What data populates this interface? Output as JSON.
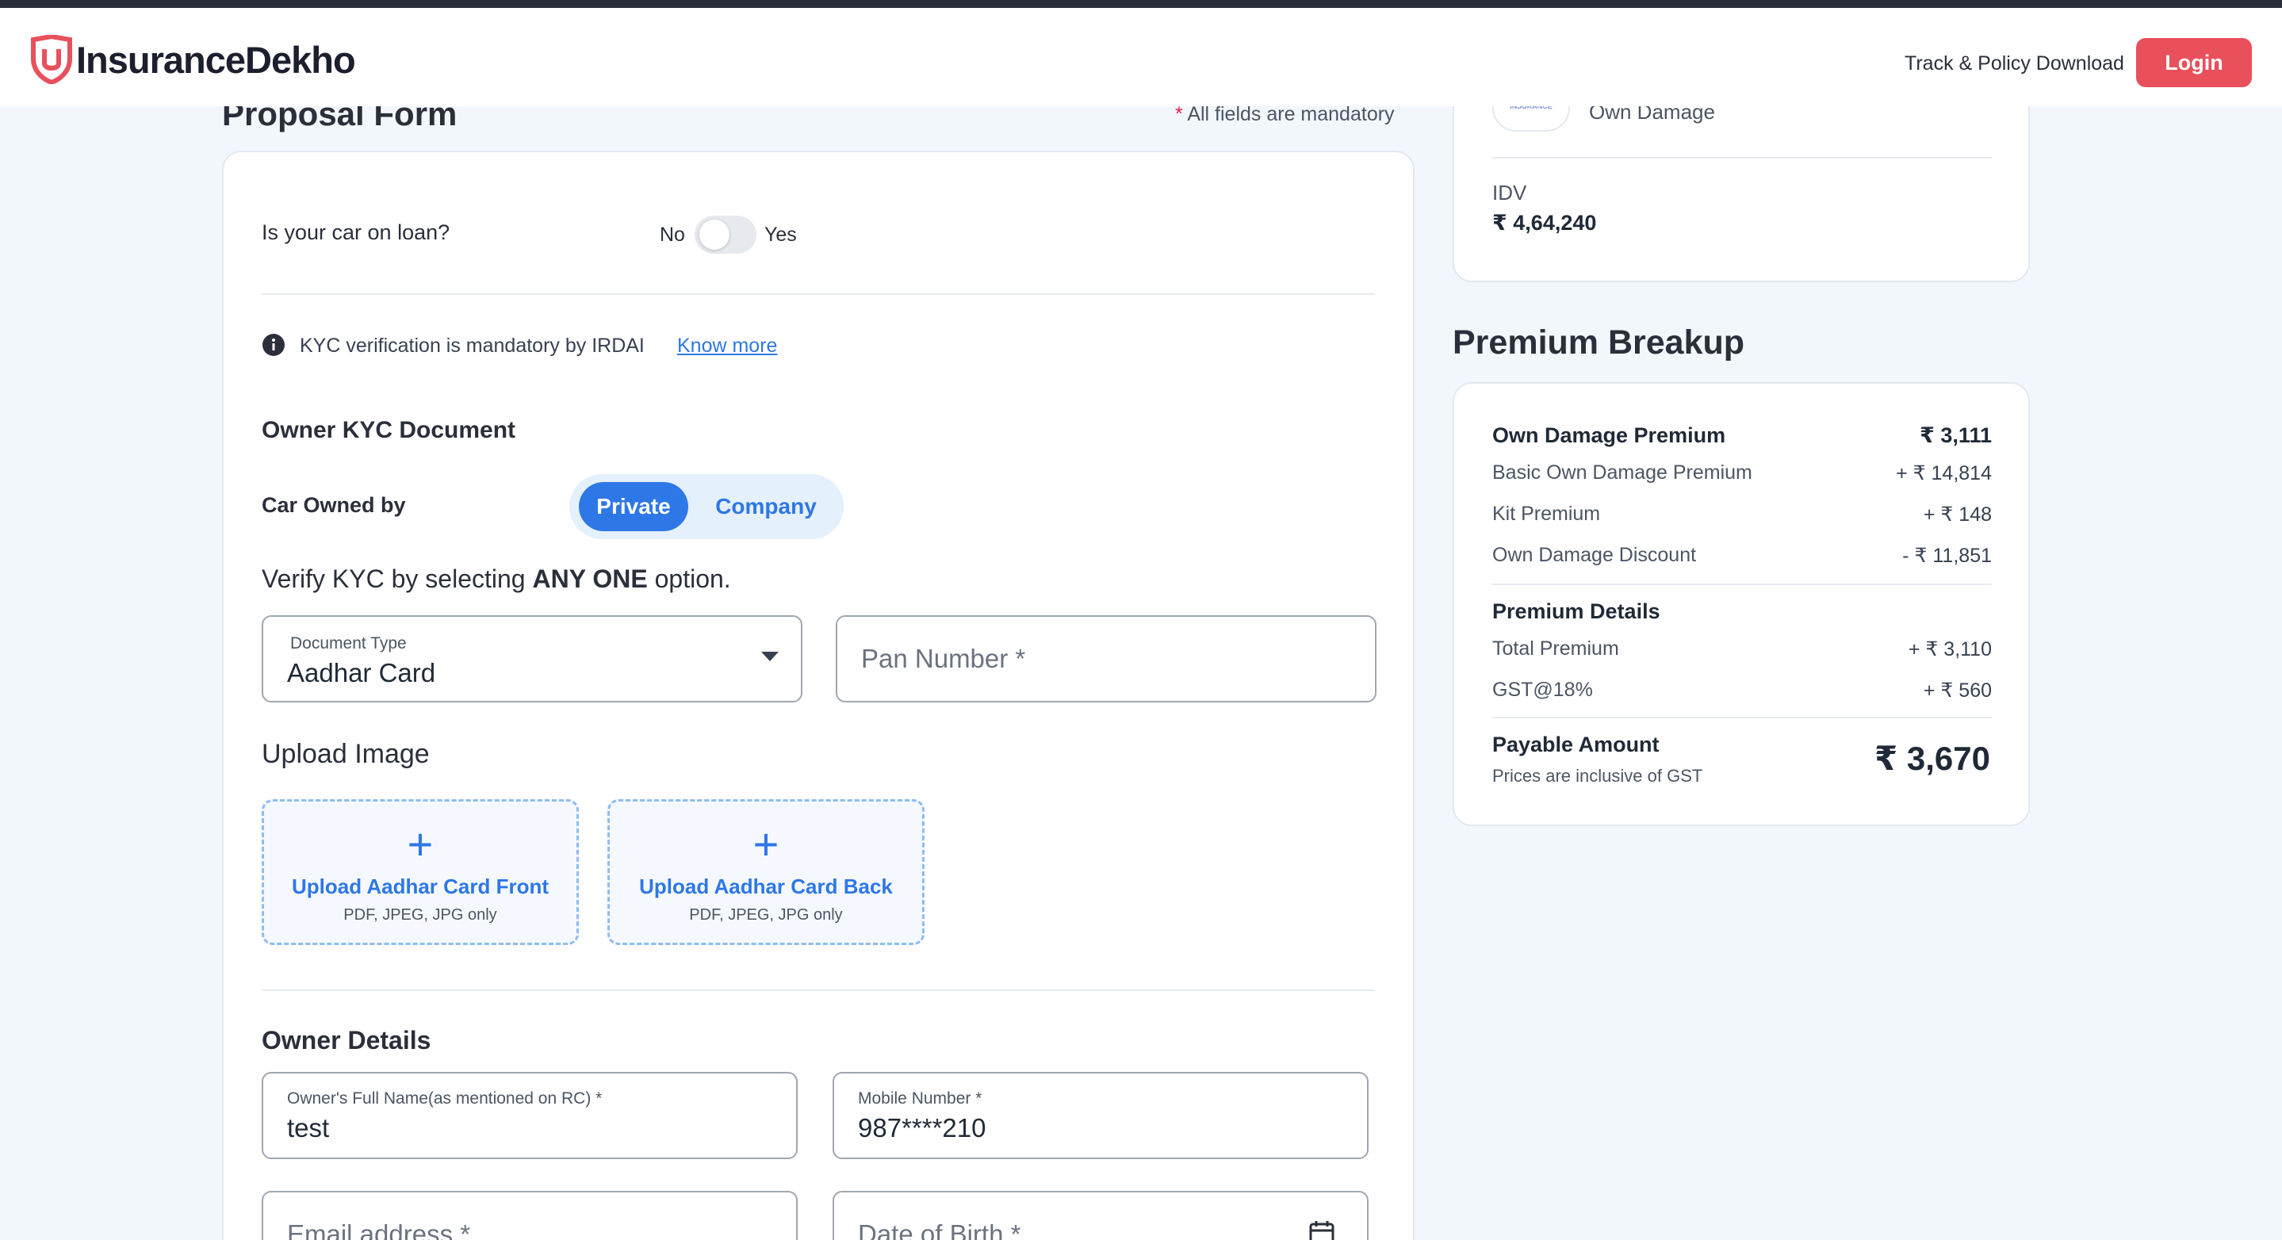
{
  "header": {
    "logo_text": "InsuranceDekho",
    "track_link": "Track & Policy Download",
    "login_label": "Login",
    "brand_color": "#e8505b"
  },
  "form": {
    "title": "Proposal Form",
    "mandatory_star": "*",
    "mandatory_note": "All fields are mandatory",
    "loan_question": "Is your car on loan?",
    "loan_no": "No",
    "loan_yes": "Yes",
    "loan_toggle_on": false,
    "kyc_note": "KYC verification is mandatory by IRDAI",
    "know_more": "Know more",
    "kyc_heading": "Owner KYC Document",
    "owned_by_label": "Car Owned by",
    "owned_by_private": "Private",
    "owned_by_company": "Company",
    "owned_by_selected": "Private",
    "verify_prefix": "Verify KYC by selecting ",
    "verify_bold": "ANY ONE",
    "verify_suffix": " option.",
    "document_type_label": "Document Type",
    "document_type_value": "Aadhar Card",
    "pan_placeholder": "Pan Number *",
    "upload_heading": "Upload Image",
    "upload_front_title": "Upload Aadhar Card Front",
    "upload_back_title": "Upload Aadhar Card Back",
    "upload_hint": "PDF, JPEG, JPG only",
    "owner_heading": "Owner Details",
    "full_name_label": "Owner's Full Name(as mentioned on RC) *",
    "full_name_value": "test",
    "mobile_label": "Mobile Number *",
    "mobile_value": "987****210",
    "email_placeholder": "Email address *",
    "dob_placeholder": "Date of Birth *",
    "accent_color": "#2e77e6"
  },
  "summary": {
    "insurer_logo_text": "INSURANCE",
    "plan_type": "Own Damage",
    "idv_label": "IDV",
    "idv_value": "₹ 4,64,240"
  },
  "premium": {
    "heading": "Premium Breakup",
    "own_damage_premium_label": "Own Damage Premium",
    "own_damage_premium_value": "₹ 3,111",
    "rows": [
      {
        "label": "Basic Own Damage Premium",
        "value": "+ ₹ 14,814"
      },
      {
        "label": "Kit Premium",
        "value": "+ ₹ 148"
      },
      {
        "label": "Own Damage Discount",
        "value": "- ₹ 11,851"
      }
    ],
    "details_heading": "Premium Details",
    "details_rows": [
      {
        "label": "Total Premium",
        "value": "+ ₹ 3,110"
      },
      {
        "label": "GST@18%",
        "value": "+ ₹ 560"
      }
    ],
    "payable_label": "Payable Amount",
    "payable_note": "Prices are inclusive of GST",
    "payable_value": "₹ 3,670"
  }
}
